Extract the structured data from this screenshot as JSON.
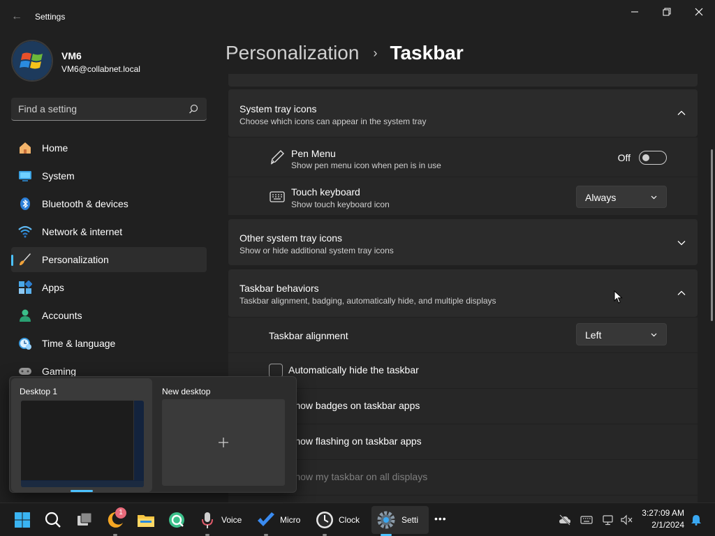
{
  "window": {
    "title": "Settings",
    "back_glyph": "←",
    "controls": [
      "minimize-icon",
      "restore-icon",
      "close-icon"
    ]
  },
  "user": {
    "name": "VM6",
    "email": "VM6@collabnet.local"
  },
  "search": {
    "placeholder": "Find a setting"
  },
  "sidebar": {
    "items": [
      {
        "label": "Home",
        "icon": "home-icon"
      },
      {
        "label": "System",
        "icon": "system-icon"
      },
      {
        "label": "Bluetooth & devices",
        "icon": "bluetooth-icon"
      },
      {
        "label": "Network & internet",
        "icon": "network-icon"
      },
      {
        "label": "Personalization",
        "icon": "personalization-icon",
        "active": true
      },
      {
        "label": "Apps",
        "icon": "apps-icon"
      },
      {
        "label": "Accounts",
        "icon": "accounts-icon"
      },
      {
        "label": "Time & language",
        "icon": "time-language-icon"
      },
      {
        "label": "Gaming",
        "icon": "gaming-icon"
      }
    ]
  },
  "header": {
    "parent": "Personalization",
    "separator": "›",
    "current": "Taskbar"
  },
  "system_tray": {
    "title": "System tray icons",
    "description": "Choose which icons can appear in the system tray",
    "expanded": true,
    "items": [
      {
        "title": "Pen Menu",
        "description": "Show pen menu icon when pen is in use",
        "icon": "pen-icon",
        "control": "toggle",
        "state_label": "Off",
        "on": false
      },
      {
        "title": "Touch keyboard",
        "description": "Show touch keyboard icon",
        "icon": "keyboard-icon",
        "control": "dropdown",
        "value": "Always"
      }
    ]
  },
  "other_tray": {
    "title": "Other system tray icons",
    "description": "Show or hide additional system tray icons",
    "expanded": false
  },
  "behaviors": {
    "title": "Taskbar behaviors",
    "description": "Taskbar alignment, badging, automatically hide, and multiple displays",
    "expanded": true,
    "alignment": {
      "label": "Taskbar alignment",
      "value": "Left"
    },
    "options": [
      {
        "label": "Automatically hide the taskbar",
        "checked": false
      },
      {
        "label": "Show badges on taskbar apps"
      },
      {
        "label": "Show flashing on taskbar apps"
      },
      {
        "label": "Show my taskbar on all displays",
        "disabled": true
      }
    ]
  },
  "task_view": {
    "desktops": [
      {
        "label": "Desktop 1",
        "active": true
      },
      {
        "label": "New desktop",
        "add_glyph": "+"
      }
    ]
  },
  "taskbar": {
    "apps": [
      {
        "name": "start-icon"
      },
      {
        "name": "search-icon"
      },
      {
        "name": "task-view-icon"
      },
      {
        "name": "moon-app-icon",
        "badge": "1"
      },
      {
        "name": "file-explorer-icon"
      },
      {
        "name": "refresh-app-icon"
      },
      {
        "name": "voice-recorder-icon",
        "label": "Voice"
      },
      {
        "name": "microsoft-todo-icon",
        "label": "Micro"
      },
      {
        "name": "clock-app-icon",
        "label": "Clock"
      },
      {
        "name": "settings-app-icon",
        "label": "Setti",
        "active": true
      },
      {
        "name": "more-icon",
        "label": "•••"
      }
    ],
    "tray": [
      "cloud-off-icon",
      "keyboard-tray-icon",
      "network-tray-icon",
      "volume-muted-icon"
    ],
    "clock": {
      "time": "3:27:09 AM",
      "date": "2/1/2024"
    },
    "notification_icon": "bell-icon"
  },
  "colors": {
    "accent": "#4cc2ff",
    "background": "#202020",
    "card": "#2b2b2b",
    "badge": "#e86a7a"
  }
}
